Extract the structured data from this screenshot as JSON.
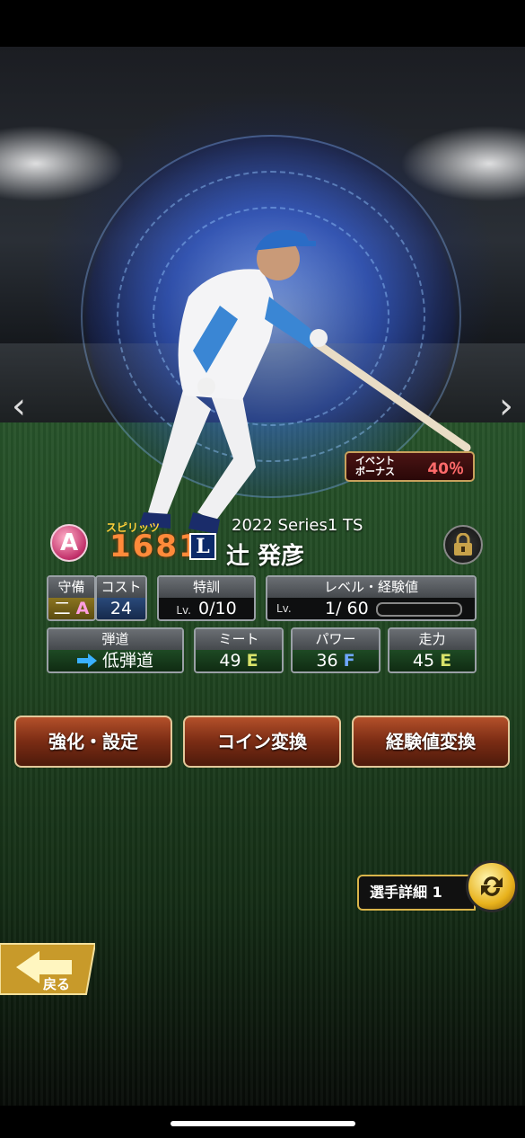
{
  "bonus": {
    "label_line1": "イベント",
    "label_line2": "ボーナス",
    "value": "40％"
  },
  "card": {
    "rank": "A",
    "spirits_label": "スピリッツ",
    "spirits_value": "1681",
    "team_logo": "L",
    "series": "2022 Series1 TS",
    "name": "辻 発彦"
  },
  "stats": {
    "defense": {
      "label": "守備",
      "position": "二",
      "grade": "A"
    },
    "cost": {
      "label": "コスト",
      "value": "24"
    },
    "training": {
      "label": "特訓",
      "lv": "Lv.",
      "value": "0/10"
    },
    "level": {
      "label": "レベル・経験値",
      "lv": "Lv.",
      "value": "1/ 60",
      "exp_fill": 0
    },
    "trajectory": {
      "label": "弾道",
      "value": "低弾道"
    },
    "meet": {
      "label": "ミート",
      "value": "49",
      "grade": "E"
    },
    "power": {
      "label": "パワー",
      "value": "36",
      "grade": "F"
    },
    "speed": {
      "label": "走力",
      "value": "45",
      "grade": "E"
    }
  },
  "buttons": {
    "enhance": "強化・設定",
    "coin_convert": "コイン変換",
    "exp_convert": "経験値変換"
  },
  "detail": {
    "label": "選手詳細 1"
  },
  "back": {
    "label": "戻る"
  },
  "icons": {
    "prev": "chevron-left-icon",
    "next": "chevron-right-icon",
    "lock": "lock-icon",
    "swap": "swap-icon",
    "arrow": "arrow-right-icon",
    "back": "back-arrow-icon"
  }
}
